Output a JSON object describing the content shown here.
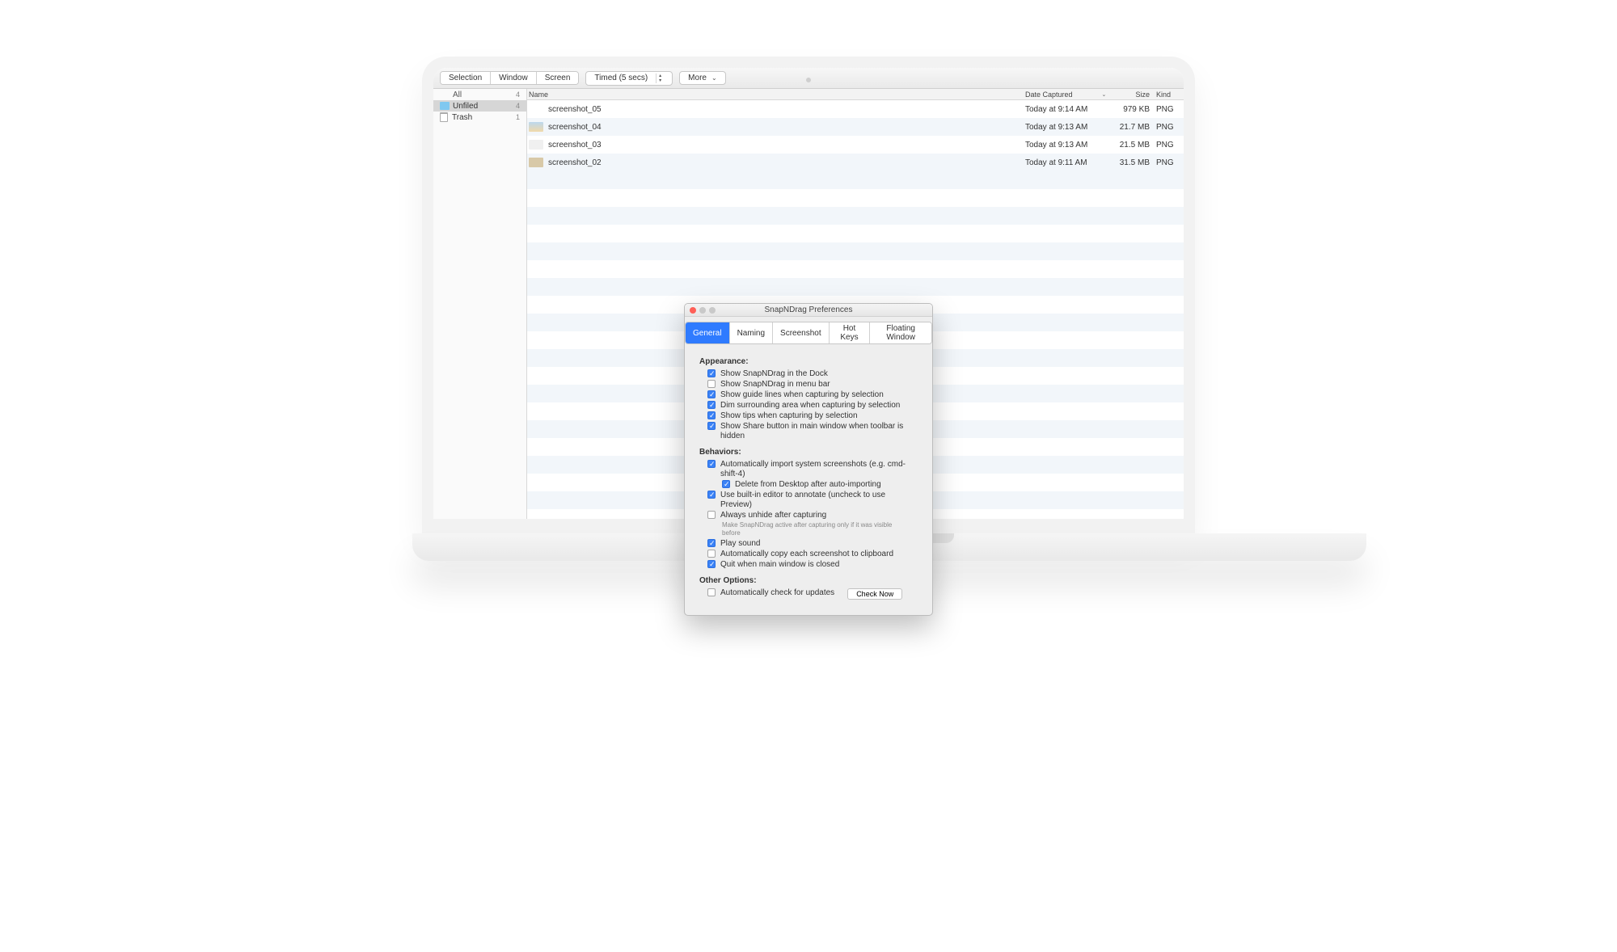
{
  "toolbar": {
    "seg1": [
      "Selection",
      "Window",
      "Screen"
    ],
    "timed": "Timed (5 secs)",
    "more": "More"
  },
  "sidebar": {
    "all": {
      "label": "All",
      "count": "4"
    },
    "unfiled": {
      "label": "Unfiled",
      "count": "4"
    },
    "trash": {
      "label": "Trash",
      "count": "1"
    }
  },
  "columns": {
    "name": "Name",
    "date": "Date Captured",
    "size": "Size",
    "kind": "Kind"
  },
  "files": [
    {
      "name": "screenshot_05",
      "date": "Today at 9:14 AM",
      "size": "979 KB",
      "kind": "PNG",
      "thumb": "empty"
    },
    {
      "name": "screenshot_04",
      "date": "Today at 9:13 AM",
      "size": "21.7 MB",
      "kind": "PNG",
      "thumb": "sky"
    },
    {
      "name": "screenshot_03",
      "date": "Today at 9:13 AM",
      "size": "21.5 MB",
      "kind": "PNG",
      "thumb": "light"
    },
    {
      "name": "screenshot_02",
      "date": "Today at 9:11 AM",
      "size": "31.5 MB",
      "kind": "PNG",
      "thumb": "default"
    }
  ],
  "prefs": {
    "title": "SnapNDrag Preferences",
    "tabs": [
      "General",
      "Naming",
      "Screenshot",
      "Hot Keys",
      "Floating Window"
    ],
    "active_tab": 0,
    "sections": {
      "appearance": {
        "title": "Appearance:",
        "items": [
          {
            "checked": true,
            "label": "Show SnapNDrag in the Dock"
          },
          {
            "checked": false,
            "label": "Show SnapNDrag in menu bar"
          },
          {
            "checked": true,
            "label": "Show guide lines when capturing by selection"
          },
          {
            "checked": true,
            "label": "Dim surrounding area when capturing by selection"
          },
          {
            "checked": true,
            "label": "Show tips when capturing by selection"
          },
          {
            "checked": true,
            "label": "Show Share button in main window when toolbar is hidden"
          }
        ]
      },
      "behaviors": {
        "title": "Behaviors:",
        "items": [
          {
            "checked": true,
            "label": "Automatically import system screenshots (e.g. cmd-shift-4)"
          },
          {
            "checked": true,
            "label": "Delete from Desktop after auto-importing",
            "indent": true
          },
          {
            "checked": true,
            "label": "Use built-in editor to annotate (uncheck to use Preview)"
          },
          {
            "checked": false,
            "label": "Always unhide after capturing",
            "hint": "Make SnapNDrag active after capturing only if it was visible before"
          },
          {
            "checked": true,
            "label": "Play sound"
          },
          {
            "checked": false,
            "label": "Automatically copy each screenshot to clipboard"
          },
          {
            "checked": true,
            "label": "Quit when main window is closed"
          }
        ]
      },
      "other": {
        "title": "Other Options:",
        "items": [
          {
            "checked": false,
            "label": "Automatically check for updates"
          }
        ],
        "check_now": "Check Now"
      }
    }
  }
}
